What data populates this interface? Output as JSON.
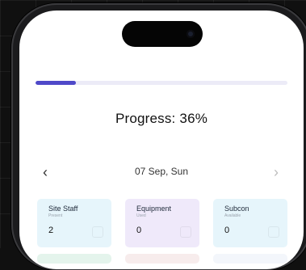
{
  "progress": {
    "percent": 36,
    "label": "Progress: 36%",
    "bar_percent": 16,
    "color": "#4f49c9",
    "track_color": "#ecebf7"
  },
  "date_nav": {
    "prev_icon": "chevron-left-icon",
    "prev_glyph": "‹",
    "date": "07 Sep, Sun",
    "next_icon": "chevron-right-icon",
    "next_glyph": "›"
  },
  "cards": [
    {
      "title": "Site Staff",
      "subtitle": "Present",
      "value": "2",
      "bg": "#e6f5fb",
      "icon": "people-icon"
    },
    {
      "title": "Equipment",
      "subtitle": "Used",
      "value": "0",
      "bg": "#efe9fa",
      "icon": "equipment-icon"
    },
    {
      "title": "Subcon",
      "subtitle": "Available",
      "value": "0",
      "bg": "#e6f5fb",
      "icon": "subcontractor-icon"
    }
  ],
  "next_row_colors": [
    "#e4f4ec",
    "#f7ecec",
    "#f3f6fb"
  ]
}
